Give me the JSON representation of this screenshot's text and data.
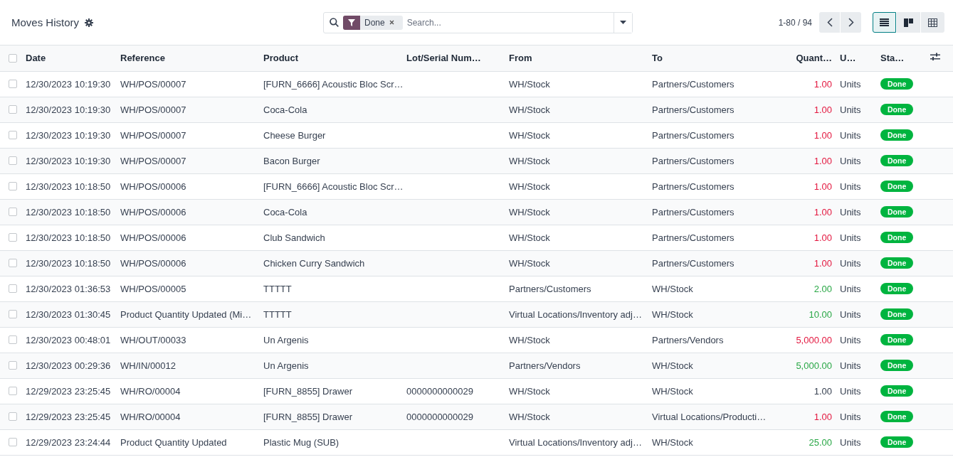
{
  "title": "Moves History",
  "search": {
    "facet": "Done",
    "placeholder": "Search..."
  },
  "pager": "1-80 / 94",
  "views": [
    {
      "kind": "list",
      "selected": true
    },
    {
      "kind": "kanban",
      "selected": false
    },
    {
      "kind": "pivot",
      "selected": false
    }
  ],
  "all_selected": false,
  "columns": [
    "Date",
    "Reference",
    "Product",
    "Lot/Serial Num…",
    "From",
    "To",
    "Quant…",
    "U…",
    "Sta…"
  ],
  "rows": [
    {
      "checked": false,
      "date": "12/30/2023 10:19:30",
      "reference": "WH/POS/00007",
      "product": "[FURN_6666] Acoustic Bloc Scr…",
      "lot": "",
      "from": "WH/Stock",
      "to": "Partners/Customers",
      "quantity": "1.00",
      "color": "#e3173f",
      "unit": "Units",
      "status": "Done"
    },
    {
      "checked": false,
      "date": "12/30/2023 10:19:30",
      "reference": "WH/POS/00007",
      "product": "Coca-Cola",
      "lot": "",
      "from": "WH/Stock",
      "to": "Partners/Customers",
      "quantity": "1.00",
      "color": "#e3173f",
      "unit": "Units",
      "status": "Done"
    },
    {
      "checked": false,
      "date": "12/30/2023 10:19:30",
      "reference": "WH/POS/00007",
      "product": "Cheese Burger",
      "lot": "",
      "from": "WH/Stock",
      "to": "Partners/Customers",
      "quantity": "1.00",
      "color": "#e3173f",
      "unit": "Units",
      "status": "Done"
    },
    {
      "checked": false,
      "date": "12/30/2023 10:19:30",
      "reference": "WH/POS/00007",
      "product": "Bacon Burger",
      "lot": "",
      "from": "WH/Stock",
      "to": "Partners/Customers",
      "quantity": "1.00",
      "color": "#e3173f",
      "unit": "Units",
      "status": "Done"
    },
    {
      "checked": false,
      "date": "12/30/2023 10:18:50",
      "reference": "WH/POS/00006",
      "product": "[FURN_6666] Acoustic Bloc Scr…",
      "lot": "",
      "from": "WH/Stock",
      "to": "Partners/Customers",
      "quantity": "1.00",
      "color": "#e3173f",
      "unit": "Units",
      "status": "Done"
    },
    {
      "checked": false,
      "date": "12/30/2023 10:18:50",
      "reference": "WH/POS/00006",
      "product": "Coca-Cola",
      "lot": "",
      "from": "WH/Stock",
      "to": "Partners/Customers",
      "quantity": "1.00",
      "color": "#e3173f",
      "unit": "Units",
      "status": "Done"
    },
    {
      "checked": false,
      "date": "12/30/2023 10:18:50",
      "reference": "WH/POS/00006",
      "product": "Club Sandwich",
      "lot": "",
      "from": "WH/Stock",
      "to": "Partners/Customers",
      "quantity": "1.00",
      "color": "#e3173f",
      "unit": "Units",
      "status": "Done"
    },
    {
      "checked": false,
      "date": "12/30/2023 10:18:50",
      "reference": "WH/POS/00006",
      "product": "Chicken Curry Sandwich",
      "lot": "",
      "from": "WH/Stock",
      "to": "Partners/Customers",
      "quantity": "1.00",
      "color": "#e3173f",
      "unit": "Units",
      "status": "Done"
    },
    {
      "checked": false,
      "date": "12/30/2023 01:36:53",
      "reference": "WH/POS/00005",
      "product": "TTTTT",
      "lot": "",
      "from": "Partners/Customers",
      "to": "WH/Stock",
      "quantity": "2.00",
      "color": "#28a745",
      "unit": "Units",
      "status": "Done"
    },
    {
      "checked": false,
      "date": "12/30/2023 01:30:45",
      "reference": "Product Quantity Updated (Mi…",
      "product": "TTTTT",
      "lot": "",
      "from": "Virtual Locations/Inventory adj…",
      "to": "WH/Stock",
      "quantity": "10.00",
      "color": "#28a745",
      "unit": "Units",
      "status": "Done"
    },
    {
      "checked": false,
      "date": "12/30/2023 00:48:01",
      "reference": "WH/OUT/00033",
      "product": "Un Argenis",
      "lot": "",
      "from": "WH/Stock",
      "to": "Partners/Vendors",
      "quantity": "5,000.00",
      "color": "#e3173f",
      "unit": "Units",
      "status": "Done"
    },
    {
      "checked": false,
      "date": "12/30/2023 00:29:36",
      "reference": "WH/IN/00012",
      "product": "Un Argenis",
      "lot": "",
      "from": "Partners/Vendors",
      "to": "WH/Stock",
      "quantity": "5,000.00",
      "color": "#28a745",
      "unit": "Units",
      "status": "Done"
    },
    {
      "checked": false,
      "date": "12/29/2023 23:25:45",
      "reference": "WH/RO/00004",
      "product": "[FURN_8855] Drawer",
      "lot": "0000000000029",
      "from": "WH/Stock",
      "to": "WH/Stock",
      "quantity": "1.00",
      "color": "#374151",
      "unit": "Units",
      "status": "Done"
    },
    {
      "checked": false,
      "date": "12/29/2023 23:25:45",
      "reference": "WH/RO/00004",
      "product": "[FURN_8855] Drawer",
      "lot": "0000000000029",
      "from": "WH/Stock",
      "to": "Virtual Locations/Producti…",
      "quantity": "1.00",
      "color": "#e3173f",
      "unit": "Units",
      "status": "Done"
    },
    {
      "checked": false,
      "date": "12/29/2023 23:24:44",
      "reference": "Product Quantity Updated",
      "product": "Plastic Mug (SUB)",
      "lot": "",
      "from": "Virtual Locations/Inventory adj…",
      "to": "WH/Stock",
      "quantity": "25.00",
      "color": "#28a745",
      "unit": "Units",
      "status": "Done"
    }
  ]
}
